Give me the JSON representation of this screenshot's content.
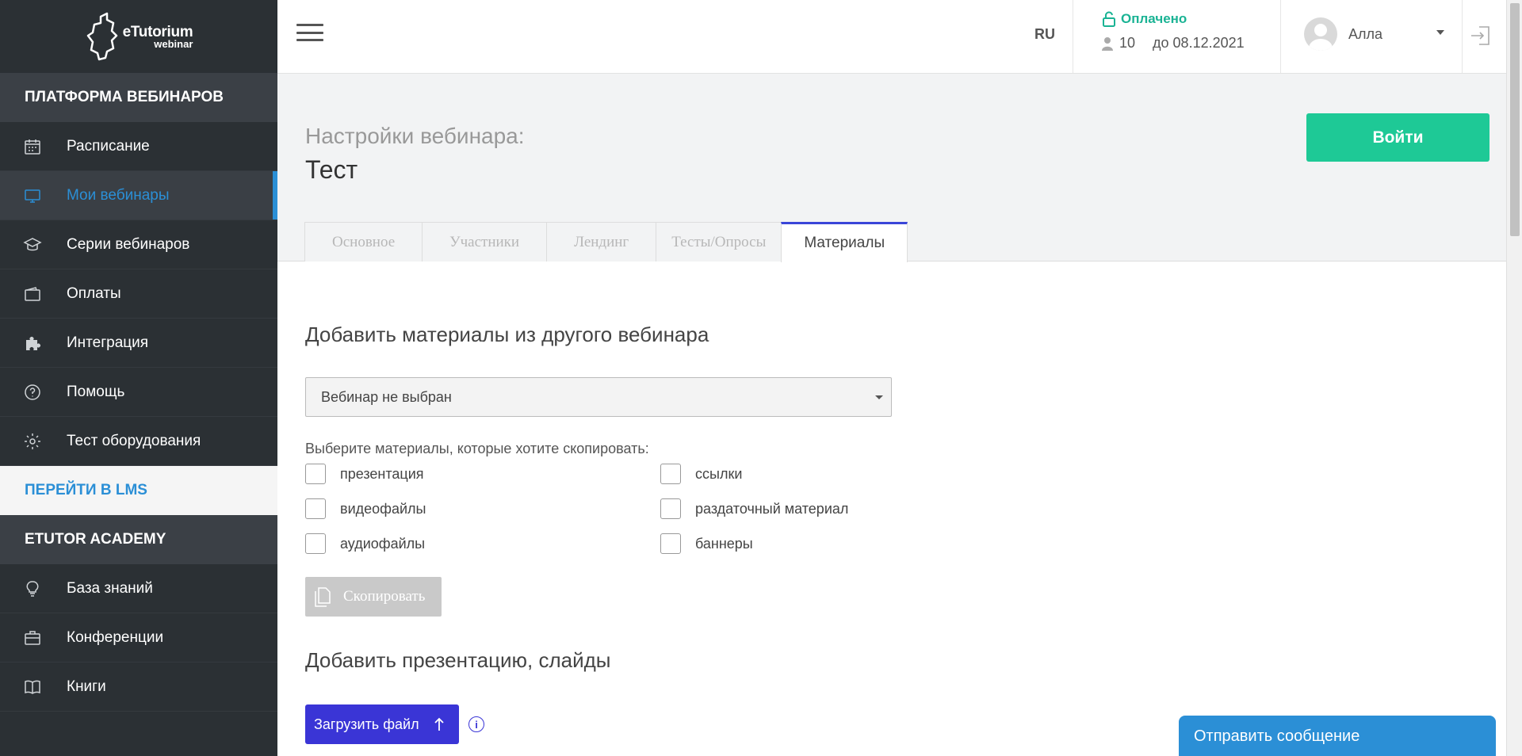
{
  "logo": {
    "line1": "eTutorium",
    "line2": "webinar"
  },
  "sidebar": {
    "section1": "ПЛАТФОРМА ВЕБИНАРОВ",
    "items1": [
      {
        "label": "Расписание",
        "icon": "calendar-icon"
      },
      {
        "label": "Мои вебинары",
        "icon": "monitor-icon"
      },
      {
        "label": "Серии вебинаров",
        "icon": "graduation-cap-icon"
      },
      {
        "label": "Оплаты",
        "icon": "wallet-icon"
      },
      {
        "label": "Интеграция",
        "icon": "puzzle-icon"
      },
      {
        "label": "Помощь",
        "icon": "help-icon"
      },
      {
        "label": "Тест оборудования",
        "icon": "gear-icon"
      }
    ],
    "lms": "ПЕРЕЙТИ В LMS",
    "section2": "ETUTOR ACADEMY",
    "items2": [
      {
        "label": "База знаний",
        "icon": "lightbulb-icon"
      },
      {
        "label": "Конференции",
        "icon": "briefcase-icon"
      },
      {
        "label": "Книги",
        "icon": "book-icon"
      }
    ]
  },
  "topbar": {
    "lang": "RU",
    "paid_label": "Оплачено",
    "seats": "10",
    "valid_until": "до 08.12.2021",
    "user_name": "Алла"
  },
  "page": {
    "subtitle": "Настройки вебинара:",
    "title": "Тест",
    "enter_button": "Войти",
    "tabs": [
      "Основное",
      "Участники",
      "Лендинг",
      "Тесты/Опросы",
      "Материалы"
    ]
  },
  "materials": {
    "copy_title": "Добавить материалы из другого вебинара",
    "select_value": "Вебинар не выбран",
    "hint": "Выберите материалы, которые хотите скопировать:",
    "options": [
      "презентация",
      "ссылки",
      "видеофайлы",
      "раздаточный материал",
      "аудиофайлы",
      "баннеры"
    ],
    "copy_button": "Скопировать",
    "presentation_title": "Добавить презентацию, слайды",
    "upload_button": "Загрузить файл"
  },
  "chat": {
    "label": "Отправить сообщение"
  },
  "colors": {
    "accent": "#2b8fd6",
    "success": "#1ec996",
    "tab_active": "#3a45d8",
    "upload": "#3a35d6",
    "sidebar_bg": "#2b3034"
  }
}
